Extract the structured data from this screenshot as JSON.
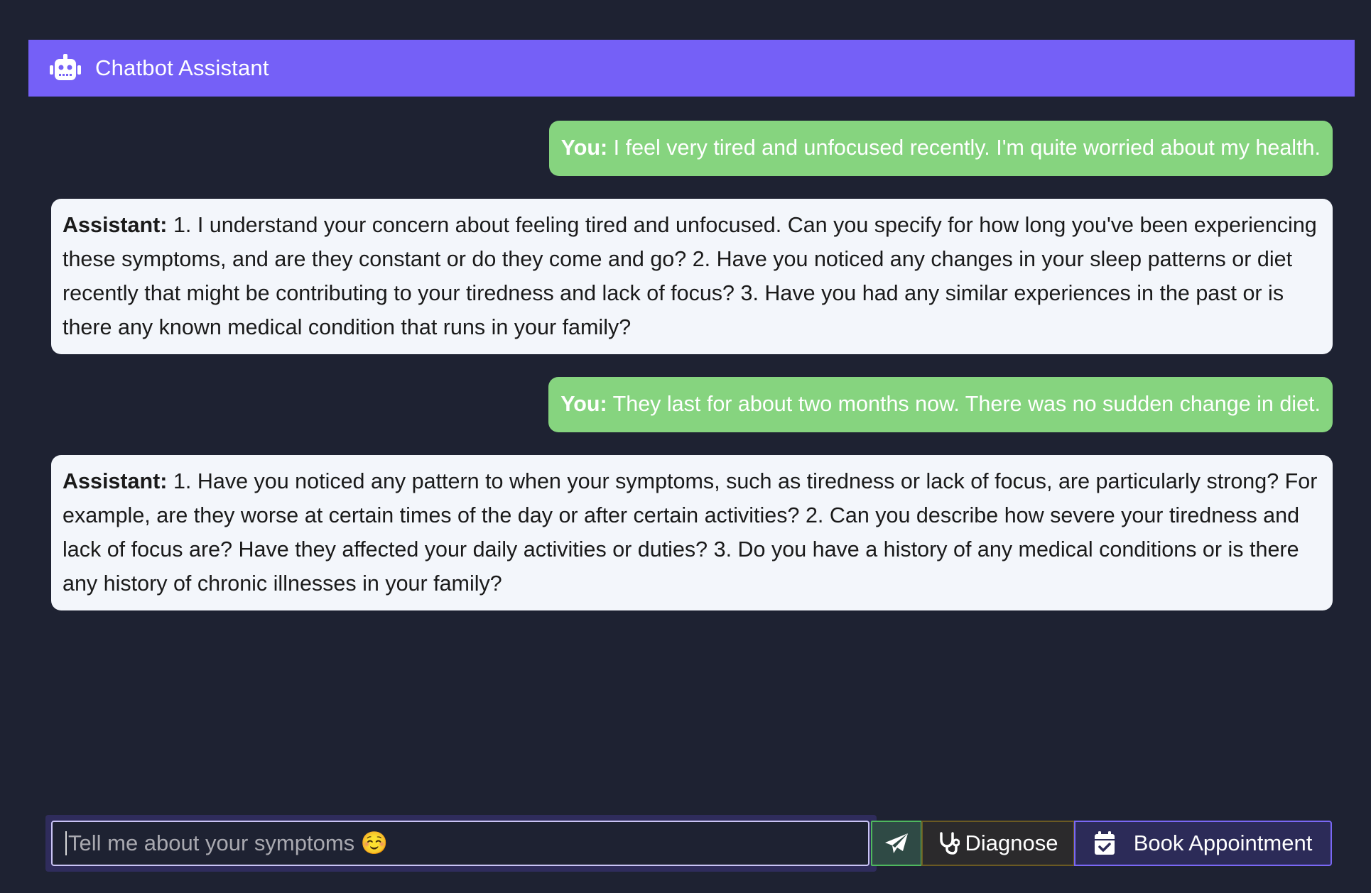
{
  "header": {
    "icon": "robot-icon",
    "title": "Chatbot Assistant"
  },
  "messages": [
    {
      "role": "user",
      "speaker": "You:",
      "text": "I feel very tired and unfocused recently. I'm quite worried about my health."
    },
    {
      "role": "assistant",
      "speaker": "Assistant:",
      "text": "1. I understand your concern about feeling tired and unfocused. Can you specify for how long you've been experiencing these symptoms, and are they constant or do they come and go? 2. Have you noticed any changes in your sleep patterns or diet recently that might be contributing to your tiredness and lack of focus? 3. Have you had any similar experiences in the past or is there any known medical condition that runs in your family?"
    },
    {
      "role": "user",
      "speaker": "You:",
      "text": "They last for about two months now. There was no sudden change in diet."
    },
    {
      "role": "assistant",
      "speaker": "Assistant:",
      "text": "1. Have you noticed any pattern to when your symptoms, such as tiredness or lack of focus, are particularly strong? For example, are they worse at certain times of the day or after certain activities? 2. Can you describe how severe your tiredness and lack of focus are? Have they affected your daily activities or duties? 3. Do you have a history of any medical conditions or is there any history of chronic illnesses in your family?"
    }
  ],
  "composer": {
    "placeholder": "Tell me about your symptoms ☺️",
    "value": "",
    "send_icon": "paper-plane-icon",
    "diagnose_icon": "stethoscope-icon",
    "diagnose_label": "Diagnose",
    "book_icon": "calendar-check-icon",
    "book_label": "Book Appointment"
  },
  "colors": {
    "background": "#1e2232",
    "header": "#7560f7",
    "user_bubble": "#86d47f",
    "assistant_bubble": "#f3f6fb"
  }
}
